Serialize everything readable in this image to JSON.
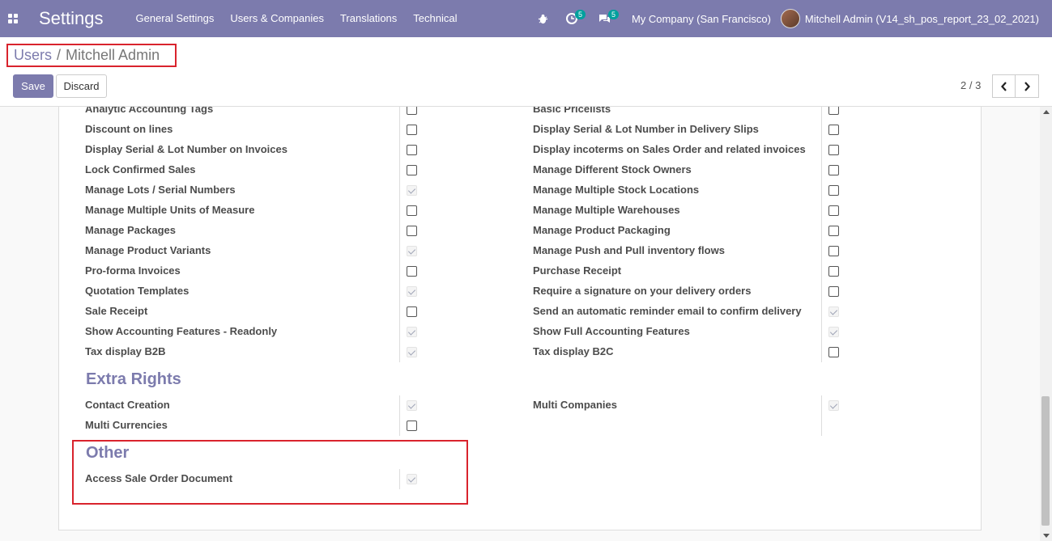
{
  "navbar": {
    "app_title": "Settings",
    "menu": [
      "General Settings",
      "Users & Companies",
      "Translations",
      "Technical"
    ],
    "activity_count": "5",
    "message_count": "5",
    "company": "My Company (San Francisco)",
    "user": "Mitchell Admin (V14_sh_pos_report_23_02_2021)"
  },
  "breadcrumb": {
    "parent": "Users",
    "separator": "/",
    "current": "Mitchell Admin"
  },
  "buttons": {
    "save": "Save",
    "discard": "Discard"
  },
  "pager": {
    "value": "2 / 3"
  },
  "technical_rights_left": [
    {
      "label": "Analytic Accounting Tags",
      "checked": false
    },
    {
      "label": "Discount on lines",
      "checked": false
    },
    {
      "label": "Display Serial & Lot Number on Invoices",
      "checked": false
    },
    {
      "label": "Lock Confirmed Sales",
      "checked": false
    },
    {
      "label": "Manage Lots / Serial Numbers",
      "checked": true
    },
    {
      "label": "Manage Multiple Units of Measure",
      "checked": false
    },
    {
      "label": "Manage Packages",
      "checked": false
    },
    {
      "label": "Manage Product Variants",
      "checked": true
    },
    {
      "label": "Pro-forma Invoices",
      "checked": false
    },
    {
      "label": "Quotation Templates",
      "checked": true
    },
    {
      "label": "Sale Receipt",
      "checked": false
    },
    {
      "label": "Show Accounting Features - Readonly",
      "checked": true
    },
    {
      "label": "Tax display B2B",
      "checked": true
    }
  ],
  "technical_rights_right": [
    {
      "label": "Basic Pricelists",
      "checked": false
    },
    {
      "label": "Display Serial & Lot Number in Delivery Slips",
      "checked": false
    },
    {
      "label": "Display incoterms on Sales Order and related invoices",
      "checked": false
    },
    {
      "label": "Manage Different Stock Owners",
      "checked": false
    },
    {
      "label": "Manage Multiple Stock Locations",
      "checked": false
    },
    {
      "label": "Manage Multiple Warehouses",
      "checked": false
    },
    {
      "label": "Manage Product Packaging",
      "checked": false
    },
    {
      "label": "Manage Push and Pull inventory flows",
      "checked": false
    },
    {
      "label": "Purchase Receipt",
      "checked": false
    },
    {
      "label": "Require a signature on your delivery orders",
      "checked": false
    },
    {
      "label": "Send an automatic reminder email to confirm delivery",
      "checked": true
    },
    {
      "label": "Show Full Accounting Features",
      "checked": true
    },
    {
      "label": "Tax display B2C",
      "checked": false
    }
  ],
  "extra_rights": {
    "title": "Extra Rights",
    "left": [
      {
        "label": "Contact Creation",
        "checked": true
      },
      {
        "label": "Multi Currencies",
        "checked": false
      }
    ],
    "right": [
      {
        "label": "Multi Companies",
        "checked": true
      }
    ]
  },
  "other": {
    "title": "Other",
    "items": [
      {
        "label": "Access Sale Order Document",
        "checked": true
      }
    ]
  }
}
